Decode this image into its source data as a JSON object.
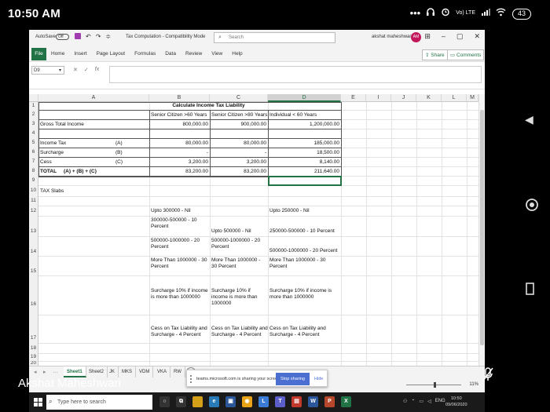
{
  "phone_status": {
    "time": "10:50 AM",
    "battery": "43",
    "signal": "Vo) LTE"
  },
  "excel": {
    "autosave_label": "AutoSave",
    "autosave_state": "Off",
    "doc_title": "Tax Computation - Compatibility Mode",
    "search_placeholder": "Search",
    "user_name": "akshat maheshwari",
    "user_initials": "AM",
    "ribbon_file": "File",
    "ribbon_tabs": [
      "Home",
      "Insert",
      "Page Layout",
      "Formulas",
      "Data",
      "Review",
      "View",
      "Help"
    ],
    "share_label": "Share",
    "comments_label": "Comments",
    "name_box": "D9",
    "columns": [
      "A",
      "B",
      "C",
      "D",
      "E",
      "I",
      "J",
      "K",
      "L",
      "M"
    ],
    "rows": [
      "1",
      "2",
      "3",
      "4",
      "5",
      "6",
      "7",
      "8",
      "9",
      "10",
      "11",
      "12",
      "13",
      "14",
      "15",
      "16",
      "17",
      "18",
      "19",
      "20"
    ],
    "cells": {
      "b1": "Calculate Income Tax Liability",
      "b2": "Senior Citizen >60 Years",
      "c2": "Senior Citizen >80 Years",
      "d2": "Individual < 60 Years",
      "a3": "Gross Total Income",
      "b3": "800,000.00",
      "c3": "900,000.00",
      "d3": "1,200,000.00",
      "a5": "Income Tax",
      "a5r": "(A)",
      "b5": "80,000.00",
      "c5": "80,000.00",
      "d5": "185,000.00",
      "a6": "Surcharge",
      "a6r": "(B)",
      "b6": "-",
      "c6": "-",
      "d6": "18,500.00",
      "a7": "Cess",
      "a7r": "(C)",
      "b7": "3,200.00",
      "c7": "3,200.00",
      "d7": "8,140.00",
      "a8": "TOTAL",
      "a8r": "(A) + (B) + (C)",
      "b8": "83,200.00",
      "c8": "83,200.00",
      "d8": "211,640.00",
      "a10": "TAX Slabs",
      "b12": "Upto 300000 - Nil",
      "d12": "Upto 250000 - Nil",
      "b13": "300000-500000 - 10 Percent",
      "c13": "Upto 500000 - Nil",
      "d13": "250000-500000 - 10 Percent",
      "b14": "500000-1000000 - 20 Percent",
      "c14": "500000-1000000 - 20 Percent",
      "d14": "500000-1000000 - 20 Percent",
      "b15": "More Than 1000000 - 30 Percent",
      "c15": "More Than 1000000 - 30 Percent",
      "d15": "More Than 1000000 - 30 Percent",
      "b16": "Surcharge 10% if income is more than 1000000",
      "c16": "Surcharge 10% if income is more than 1000000",
      "d16": "Surcharge 10% if income is more than 1000000",
      "b17": "Cess on Tax Liability and Surcharge - 4 Percent",
      "c17": "Cess on Tax Liability and Surcharge - 4 Percent",
      "d17": "Cess on Tax Liability and Surcharge - 4 Percent"
    },
    "sheet_tabs": [
      "Sheet1",
      "Sheet2",
      "JK",
      "MKS",
      "VDM",
      "VKA",
      "RW"
    ],
    "active_sheet": "Sheet1",
    "zoom": "11%"
  },
  "teams_bar": {
    "message": "teams.microsoft.com is sharing your screen.",
    "stop_label": "Stop sharing",
    "hide_label": "Hide"
  },
  "presenter_name": "Akshat Maheshwari",
  "taskbar": {
    "search_placeholder": "Type here to search",
    "language": "ENG",
    "clock_time": "10:50",
    "clock_date": "09/06/2020"
  },
  "accent": "#217346"
}
